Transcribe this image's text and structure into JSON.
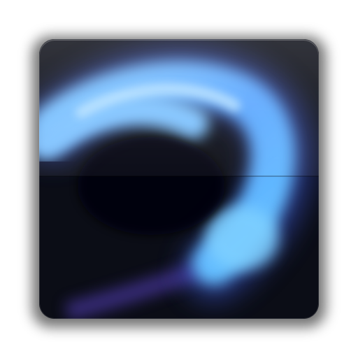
{
  "icon": {
    "name": "blue-swirl-app-icon",
    "colors": {
      "background": "#0b0d16",
      "glow_light": "#8fd0ff",
      "glow_mid": "#5aa6ff",
      "glow_deep": "#3a52c8",
      "accent_purple": "#6b4ad6"
    }
  }
}
